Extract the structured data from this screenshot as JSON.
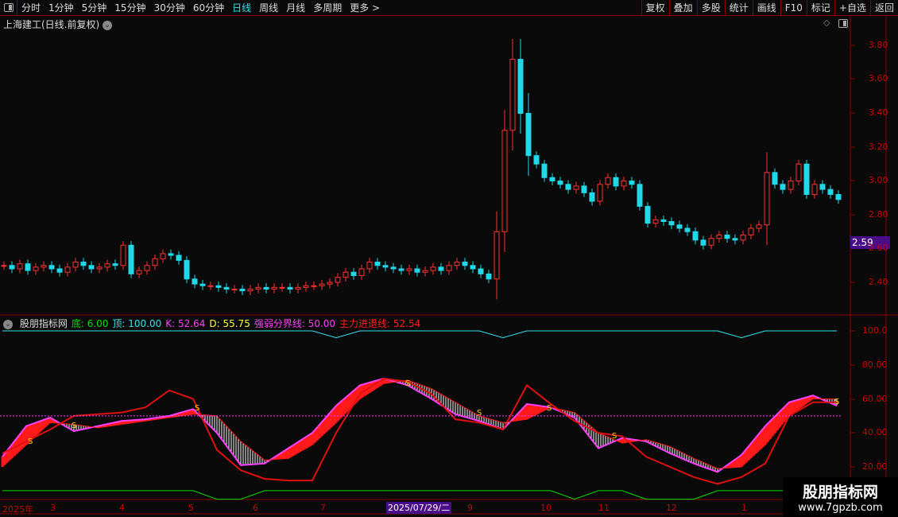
{
  "toolbar": {
    "tabs": [
      "分时",
      "1分钟",
      "5分钟",
      "15分钟",
      "30分钟",
      "60分钟",
      "日线",
      "周线",
      "月线",
      "多周期",
      "更多 >"
    ],
    "active": "日线",
    "right_buttons": [
      "复权",
      "叠加",
      "多股",
      "统计",
      "画线",
      "F10",
      "标记",
      "+自选",
      "返回"
    ]
  },
  "title": "上海建工(日线.前复权)",
  "price_axis": [
    "3.80",
    "3.60",
    "3.40",
    "3.20",
    "3.00",
    "2.80",
    "2.60",
    "2.40"
  ],
  "current_price": "2.59",
  "indicator": {
    "name": "股朋指标网",
    "items": [
      {
        "label": "底: 6.00",
        "color": "#00e000"
      },
      {
        "label": "顶: 100.00",
        "color": "#2ee6f0"
      },
      {
        "label": "K: 52.64",
        "color": "#ff40ff"
      },
      {
        "label": "D: 55.75",
        "color": "#ffff40"
      },
      {
        "label": "强弱分界线: 50.00",
        "color": "#ff40ff"
      },
      {
        "label": "主力进退线: 52.54",
        "color": "#ff2020"
      }
    ],
    "axis": [
      "100.0",
      "80.00",
      "60.00",
      "40.00",
      "20.00"
    ]
  },
  "time_axis": [
    "2025年",
    "3",
    "4",
    "5",
    "6",
    "7",
    "9",
    "10",
    "11",
    "12",
    "1"
  ],
  "cursor_date": "2025/07/29/二",
  "watermark": {
    "name": "股朋指标网",
    "url": "www.7gpzb.com"
  },
  "colors": {
    "up": "#ff3030",
    "down": "#20d8e8",
    "accent": "#4b0c87",
    "border": "#8b0000"
  },
  "chart_data": [
    {
      "type": "candlestick",
      "title": "上海建工 日线",
      "ylim": [
        2.3,
        3.9
      ],
      "closes": [
        2.5,
        2.48,
        2.51,
        2.47,
        2.49,
        2.5,
        2.48,
        2.46,
        2.49,
        2.52,
        2.5,
        2.48,
        2.49,
        2.51,
        2.5,
        2.62,
        2.45,
        2.47,
        2.5,
        2.54,
        2.57,
        2.56,
        2.53,
        2.42,
        2.39,
        2.38,
        2.38,
        2.37,
        2.36,
        2.36,
        2.35,
        2.36,
        2.37,
        2.36,
        2.37,
        2.37,
        2.36,
        2.37,
        2.38,
        2.38,
        2.39,
        2.4,
        2.43,
        2.46,
        2.44,
        2.48,
        2.52,
        2.5,
        2.49,
        2.48,
        2.47,
        2.48,
        2.46,
        2.47,
        2.49,
        2.47,
        2.5,
        2.52,
        2.5,
        2.48,
        2.45,
        2.42,
        2.7,
        3.3,
        3.72,
        3.4,
        3.15,
        3.1,
        3.02,
        3.0,
        2.98,
        2.95,
        2.97,
        2.93,
        2.88,
        2.98,
        3.02,
        2.97,
        3.0,
        2.98,
        2.85,
        2.75,
        2.77,
        2.76,
        2.74,
        2.72,
        2.7,
        2.65,
        2.62,
        2.66,
        2.68,
        2.66,
        2.65,
        2.68,
        2.72,
        2.74,
        3.05,
        2.98,
        2.95,
        3.0,
        3.1,
        2.92,
        2.98,
        2.95,
        2.92,
        2.89
      ]
    },
    {
      "type": "line",
      "title": "股朋指标网",
      "ylim": [
        0,
        105
      ],
      "series": [
        {
          "name": "K",
          "values": [
            26,
            44,
            49,
            41,
            44,
            47,
            48,
            50,
            54,
            40,
            21,
            22,
            31,
            40,
            56,
            68,
            72,
            68,
            60,
            51,
            47,
            42,
            57,
            55,
            49,
            31,
            37,
            35,
            28,
            22,
            17,
            27,
            44,
            58,
            62,
            56
          ]
        },
        {
          "name": "D",
          "values": [
            20,
            33,
            46,
            45,
            43,
            45,
            47,
            49,
            51,
            50,
            35,
            24,
            25,
            33,
            46,
            60,
            69,
            71,
            66,
            58,
            50,
            46,
            48,
            55,
            52,
            40,
            34,
            36,
            32,
            25,
            19,
            20,
            33,
            50,
            60,
            60
          ]
        },
        {
          "name": "主力进退线",
          "values": [
            28,
            35,
            42,
            50,
            51,
            52,
            55,
            65,
            60,
            30,
            18,
            13,
            12,
            12,
            40,
            63,
            72,
            70,
            63,
            48,
            46,
            42,
            68,
            57,
            47,
            40,
            38,
            26,
            20,
            14,
            10,
            14,
            22,
            50,
            58,
            58
          ]
        },
        {
          "name": "强弱分界线",
          "value": 50
        },
        {
          "name": "顶",
          "values": [
            100,
            100,
            100,
            100,
            100,
            100,
            100,
            100,
            100,
            100,
            100,
            100,
            100,
            100,
            96,
            100,
            100,
            100,
            100,
            100,
            100,
            96,
            100,
            100,
            100,
            100,
            100,
            100,
            100,
            100,
            100,
            96,
            100,
            100,
            100,
            100
          ]
        },
        {
          "name": "底",
          "values": [
            6,
            6,
            6,
            6,
            6,
            6,
            6,
            6,
            6,
            1,
            1,
            6,
            6,
            6,
            6,
            6,
            6,
            6,
            6,
            6,
            6,
            6,
            6,
            6,
            1,
            6,
            6,
            1,
            1,
            1,
            6,
            6,
            6,
            6,
            6,
            6
          ]
        }
      ]
    }
  ]
}
